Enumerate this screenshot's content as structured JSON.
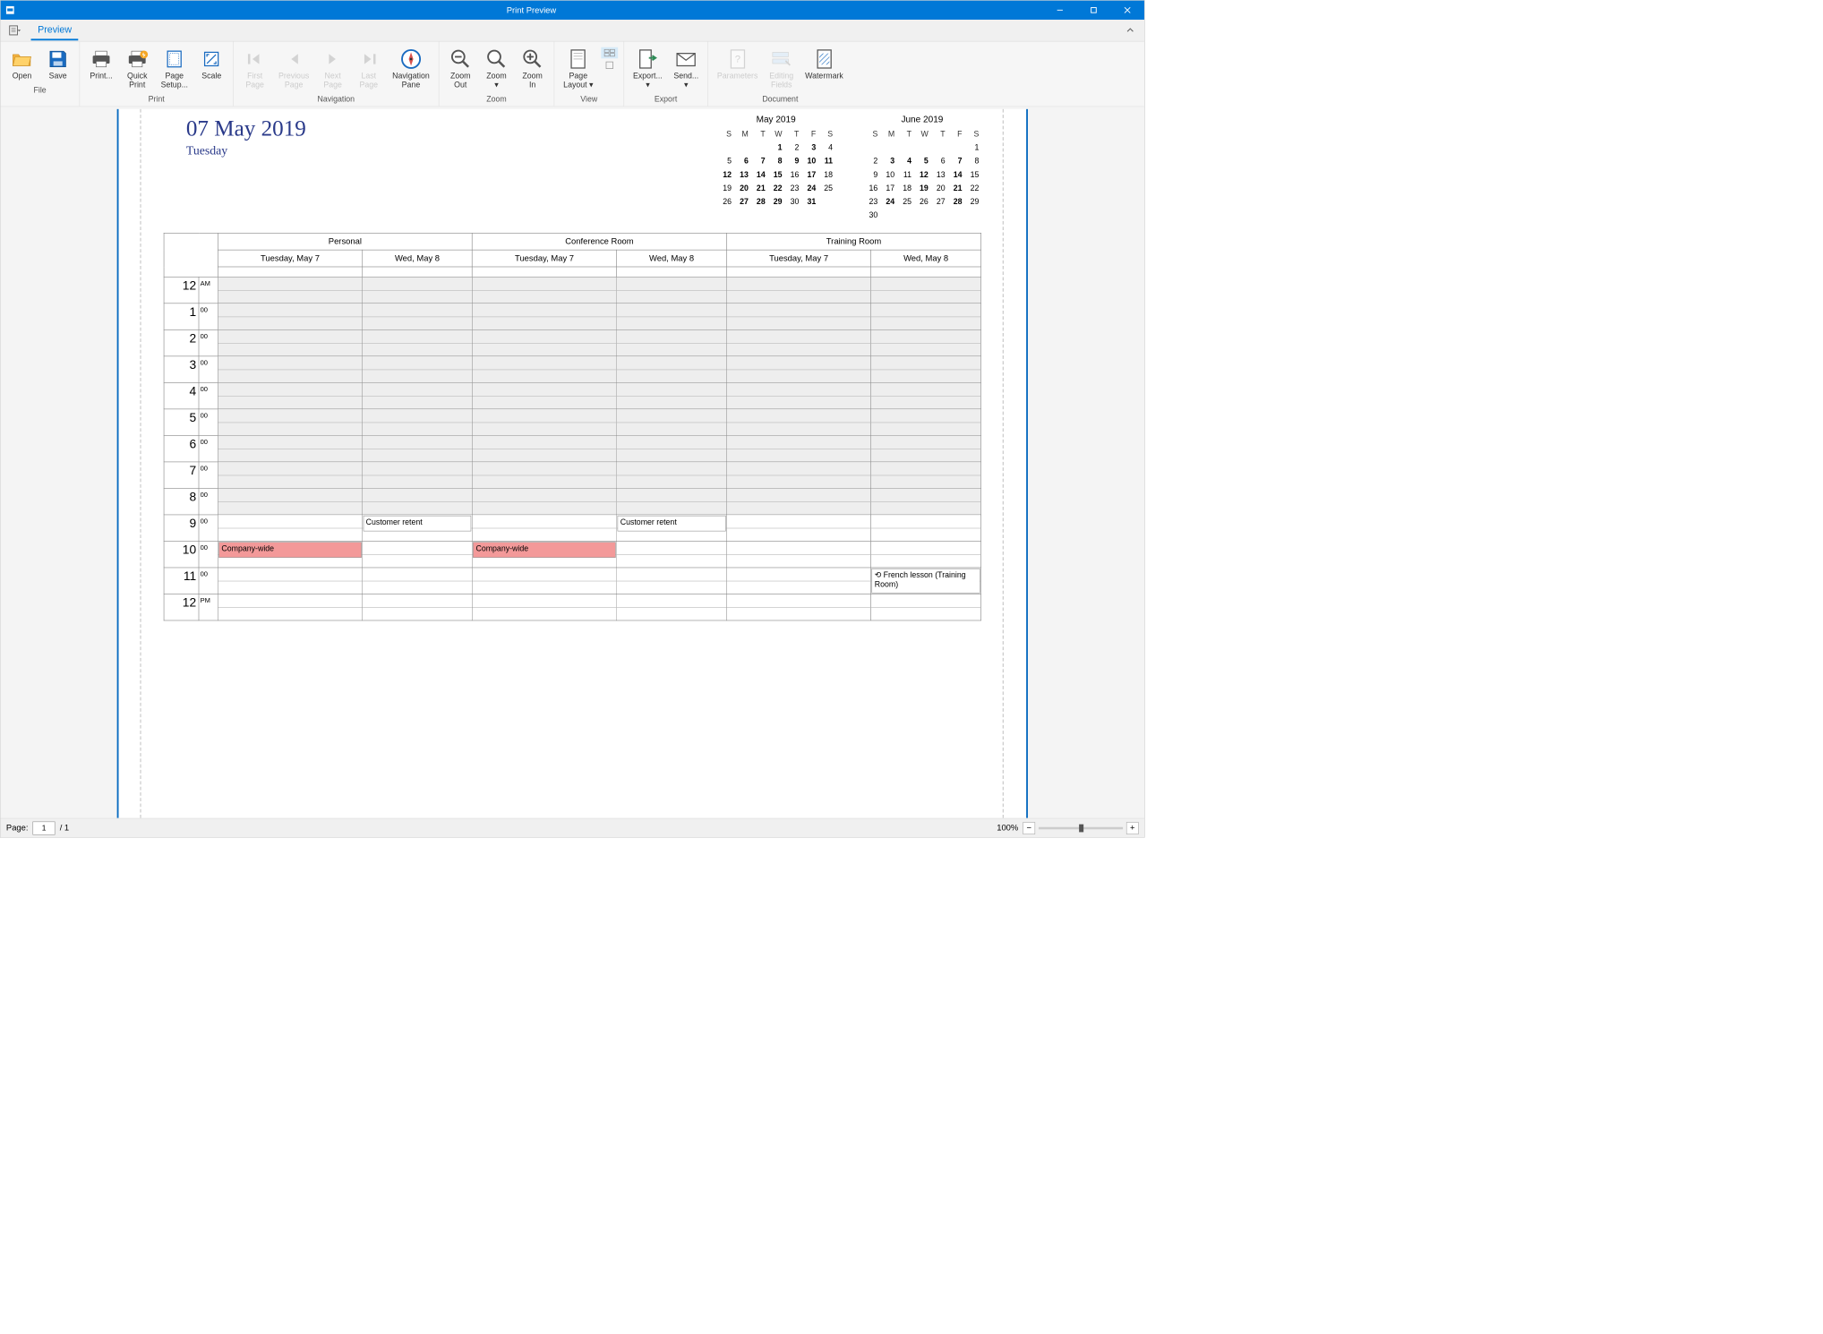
{
  "window": {
    "title": "Print Preview"
  },
  "tabs": {
    "preview": "Preview"
  },
  "ribbon": {
    "file": {
      "label": "File",
      "open": "Open",
      "save": "Save"
    },
    "print": {
      "label": "Print",
      "print": "Print...",
      "quick_print": "Quick\nPrint",
      "page_setup": "Page\nSetup...",
      "scale": "Scale"
    },
    "navigation": {
      "label": "Navigation",
      "first": "First\nPage",
      "prev": "Previous\nPage",
      "next": "Next\nPage",
      "last": "Last\nPage",
      "navpane": "Navigation\nPane"
    },
    "zoom": {
      "label": "Zoom",
      "out": "Zoom\nOut",
      "zoom": "Zoom\n▾",
      "in": "Zoom\nIn"
    },
    "view": {
      "label": "View",
      "page_layout": "Page\nLayout ▾"
    },
    "export": {
      "label": "Export",
      "export": "Export...\n▾",
      "send": "Send...\n▾"
    },
    "document": {
      "label": "Document",
      "parameters": "Parameters",
      "editing": "Editing\nFields",
      "watermark": "Watermark"
    }
  },
  "doc": {
    "big_date": "07 May 2019",
    "weekday": "Tuesday",
    "cal1": {
      "title": "May 2019",
      "dow": [
        "S",
        "M",
        "T",
        "W",
        "T",
        "F",
        "S"
      ],
      "weeks": [
        [
          "",
          "",
          "",
          "1",
          "2",
          "3",
          "4"
        ],
        [
          "5",
          "6",
          "7",
          "8",
          "9",
          "10",
          "11"
        ],
        [
          "12",
          "13",
          "14",
          "15",
          "16",
          "17",
          "18"
        ],
        [
          "19",
          "20",
          "21",
          "22",
          "23",
          "24",
          "25"
        ],
        [
          "26",
          "27",
          "28",
          "29",
          "30",
          "31",
          ""
        ]
      ],
      "bold": [
        "1",
        "3",
        "6",
        "7",
        "8",
        "9",
        "10",
        "11",
        "12",
        "13",
        "14",
        "15",
        "17",
        "20",
        "21",
        "22",
        "24",
        "27",
        "28",
        "29",
        "31"
      ]
    },
    "cal2": {
      "title": "June 2019",
      "dow": [
        "S",
        "M",
        "T",
        "W",
        "T",
        "F",
        "S"
      ],
      "weeks": [
        [
          "",
          "",
          "",
          "",
          "",
          "",
          "1"
        ],
        [
          "2",
          "3",
          "4",
          "5",
          "6",
          "7",
          "8"
        ],
        [
          "9",
          "10",
          "11",
          "12",
          "13",
          "14",
          "15"
        ],
        [
          "16",
          "17",
          "18",
          "19",
          "20",
          "21",
          "22"
        ],
        [
          "23",
          "24",
          "25",
          "26",
          "27",
          "28",
          "29"
        ],
        [
          "30",
          "",
          "",
          "",
          "",
          "",
          ""
        ]
      ],
      "bold": [
        "3",
        "4",
        "5",
        "7",
        "12",
        "14",
        "19",
        "21",
        "24",
        "28"
      ]
    },
    "rooms": [
      "Personal",
      "Conference Room",
      "Training Room"
    ],
    "days": [
      "Tuesday, May 7",
      "Wed, May 8"
    ],
    "hours": [
      "12",
      "1",
      "2",
      "3",
      "4",
      "5",
      "6",
      "7",
      "8",
      "9",
      "10",
      "11",
      "12"
    ],
    "events": {
      "company_wide": "Company-wide",
      "customer_retent": "Customer retent",
      "french": "French lesson (Training Room)"
    }
  },
  "status": {
    "page_label": "Page:",
    "page_value": "1",
    "total_pages": "/ 1",
    "zoom_pct": "100%"
  }
}
